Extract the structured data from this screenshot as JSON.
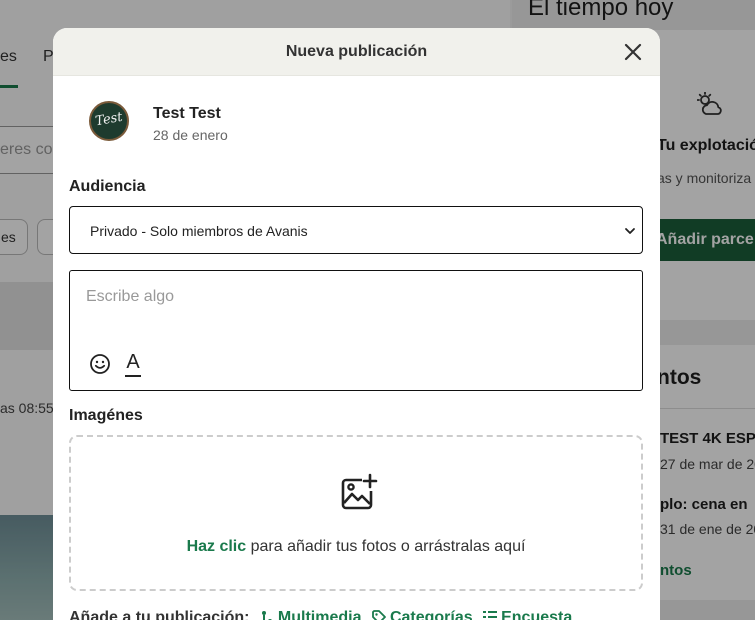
{
  "background": {
    "tabs": [
      "es",
      "P"
    ],
    "search_placeholder": "eres co",
    "chips": [
      "es",
      ""
    ],
    "post_time": "as 08:55",
    "weather": {
      "title": "El tiempo hoy",
      "explotacion": "Tu explotación",
      "monitoriza": "as y monitoriza",
      "add_parcela": "Añadir parce"
    },
    "events": {
      "title": "ntos",
      "event1_title": "TEST 4K ESP",
      "event1_date": "27 de mar de 20",
      "event2_title": "plo: cena en",
      "event2_date": "31 de ene de 20",
      "link": "ntos"
    }
  },
  "modal": {
    "title": "Nueva publicación",
    "user": {
      "name": "Test Test",
      "date": "28 de enero",
      "avatar_text": "Test"
    },
    "audience": {
      "label": "Audiencia",
      "selected": "Privado - Solo miembros de Avanis"
    },
    "composer": {
      "placeholder": "Escribe algo",
      "format_letter": "A"
    },
    "images": {
      "label": "Imagénes",
      "link": "Haz clic",
      "text": " para añadir tus fotos o arrástralas aquí"
    },
    "add_to_post": {
      "label": "Añade a tu publicación:",
      "options": [
        "Multimedia",
        "Categorías",
        "Encuesta"
      ]
    }
  },
  "colors": {
    "accent": "#1a7a4c",
    "header_bg": "#f1f1ec",
    "dark_button": "#1b5e3b"
  }
}
